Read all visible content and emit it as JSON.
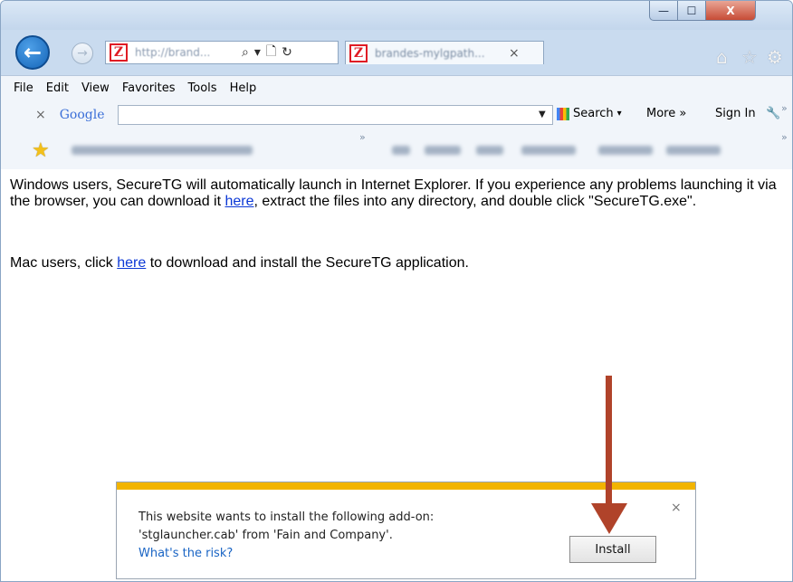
{
  "window": {
    "min_label": "—",
    "max_label": "☐",
    "close_label": "X"
  },
  "nav": {
    "back_icon": "←",
    "forward_icon": "→",
    "address_text": "http://brand...",
    "favicon_glyph": "Z",
    "search_icon": "⌕",
    "dropdown_icon": "▾",
    "compat_icon": "🗋",
    "refresh_icon": "↻",
    "tab_text": "brandes-mylgpath...",
    "tab_close": "×",
    "home_icon": "⌂",
    "favorites_icon": "☆",
    "settings_icon": "⚙"
  },
  "menu": {
    "items": [
      "File",
      "Edit",
      "View",
      "Favorites",
      "Tools",
      "Help"
    ]
  },
  "googlebar": {
    "close": "×",
    "logo": "Google",
    "search_label": "Search",
    "more_label": "More »",
    "signin_label": "Sign In",
    "overflow": "»"
  },
  "favbar": {
    "overflow": "»"
  },
  "content": {
    "para1_a": "Windows users, SecureTG will automatically launch in Internet Explorer. If you experience any problems launching it via the browser, you can download it ",
    "para1_link": "here",
    "para1_b": ", extract the files into any directory, and double click \"SecureTG.exe\".",
    "para2_a": "Mac users, click ",
    "para2_link": "here",
    "para2_b": " to download and install the SecureTG application."
  },
  "notification": {
    "line1": "This website wants to install the following add-on:",
    "line2": "'stglauncher.cab' from 'Fain and Company'.",
    "risk_link": "What's the risk?",
    "install_label": "Install",
    "close": "×"
  },
  "colors": {
    "accent_arrow": "#b0432a",
    "notification_bar": "#f2b400",
    "link": "#0b38d6"
  }
}
